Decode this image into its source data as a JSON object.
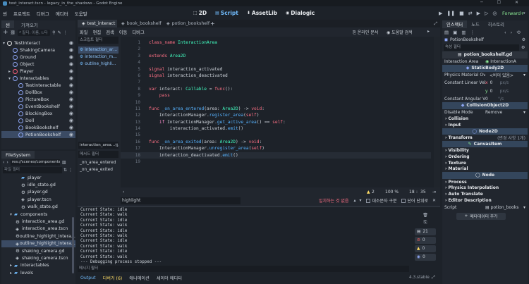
{
  "window": {
    "title": "test_interact.tscn - legacy_in_the_shadows - Godot Engine"
  },
  "menubar": {
    "items": [
      "씬",
      "프로젝트",
      "디버그",
      "에디터",
      "도움말"
    ]
  },
  "workspaces": {
    "items": [
      "2D",
      "Script",
      "AssetLib",
      "Dialogic"
    ],
    "active": "Script"
  },
  "renderer": "Forward+",
  "scene_dock": {
    "tabs": [
      "씬",
      "가져오기"
    ],
    "filter_placeholder": "필터: 이름, t:타",
    "nodes": [
      {
        "name": "TestInteract",
        "depth": 0,
        "color": "#e0e0e0",
        "visible": true,
        "collapse": "▾"
      },
      {
        "name": "ShakingCamera",
        "depth": 1,
        "color": "#8da5f3",
        "visible": true
      },
      {
        "name": "Ground",
        "depth": 1,
        "color": "#8da5f3",
        "visible": true
      },
      {
        "name": "Object",
        "depth": 1,
        "color": "#8da5f3",
        "visible": true
      },
      {
        "name": "Player",
        "depth": 1,
        "color": "#ff5f7a",
        "visible": true,
        "collapse": "▸"
      },
      {
        "name": "Interactables",
        "depth": 1,
        "color": "#8da5f3",
        "visible": true,
        "collapse": "▾"
      },
      {
        "name": "TestInteractable",
        "depth": 2,
        "color": "#8da5f3",
        "visible": true
      },
      {
        "name": "DollBox",
        "depth": 2,
        "color": "#8da5f3",
        "visible": true
      },
      {
        "name": "PictureBox",
        "depth": 2,
        "color": "#8da5f3",
        "visible": true
      },
      {
        "name": "EventBookshelf",
        "depth": 2,
        "color": "#8da5f3",
        "visible": true
      },
      {
        "name": "BlockingBox",
        "depth": 2,
        "color": "#8da5f3",
        "visible": true
      },
      {
        "name": "Doll",
        "depth": 2,
        "color": "#8da5f3",
        "visible": true
      },
      {
        "name": "BookBookshelf",
        "depth": 2,
        "color": "#8da5f3",
        "visible": true
      },
      {
        "name": "PotionBookshelf",
        "depth": 2,
        "color": "#8da5f3",
        "visible": true,
        "selected": true
      }
    ]
  },
  "filesystem": {
    "tab": "FileSystem",
    "path": "res://scenes/components/o",
    "filter_placeholder": "파일 필터",
    "items": [
      {
        "name": "player",
        "depth": 3,
        "type": "folder"
      },
      {
        "name": "idle_state.gd",
        "depth": 3,
        "type": "script"
      },
      {
        "name": "player.gd",
        "depth": 3,
        "type": "script"
      },
      {
        "name": "player.tscn",
        "depth": 3,
        "type": "scene"
      },
      {
        "name": "walk_state.gd",
        "depth": 3,
        "type": "script"
      },
      {
        "name": "components",
        "depth": 1,
        "type": "folder",
        "collapse": "▾"
      },
      {
        "name": "interaction_area.gd",
        "depth": 2,
        "type": "script"
      },
      {
        "name": "interaction_area.tscn",
        "depth": 2,
        "type": "scene"
      },
      {
        "name": "outline_highlight_intera…",
        "depth": 2,
        "type": "script"
      },
      {
        "name": "outline_highlight_intera…",
        "depth": 2,
        "type": "scene",
        "selected": true
      },
      {
        "name": "shaking_camera.gd",
        "depth": 2,
        "type": "script"
      },
      {
        "name": "shaking_camera.tscn",
        "depth": 2,
        "type": "scene"
      },
      {
        "name": "interactables",
        "depth": 1,
        "type": "folder",
        "collapse": "▸"
      },
      {
        "name": "levels",
        "depth": 1,
        "type": "folder",
        "collapse": "▸"
      }
    ]
  },
  "script_editor": {
    "tabs": [
      {
        "label": "test_interact",
        "active": true,
        "icon": "scene"
      },
      {
        "label": "book_bookshelf",
        "icon": "scene"
      },
      {
        "label": "potion_bookshelf",
        "icon": "scene"
      }
    ],
    "menu": [
      "파일",
      "편집",
      "검색",
      "이동",
      "디버그"
    ],
    "online_docs": "온라인 문서",
    "help_search": "도움말 검색",
    "script_filter": "스크립트 필터",
    "scripts": [
      "interaction_ar…",
      "interaction_m…",
      "outline_highli…"
    ],
    "current_script": "interaction_area…",
    "method_filter": "메서드 필터",
    "methods": [
      "_on_area_entered",
      "_on_area_exited"
    ],
    "line_count": 19,
    "highlight_line": 18,
    "cursor": {
      "line": "18",
      "col": "35"
    },
    "warnings": "2",
    "zoom": "100 %",
    "find": {
      "value": "highlight",
      "no_match": "일치하는 것 없음",
      "match_case": "대소문자 구분",
      "whole_words": "단어 단위로"
    }
  },
  "output": {
    "lines": [
      "Current State: idle",
      "Current State: walk",
      "Current State: idle",
      "Current State: walk",
      "Current State: idle",
      "Current State: walk",
      "Current State: idle",
      "Current State: walk",
      "Current State: idle",
      "Current State: walk",
      "--- Debugging process stopped ---"
    ],
    "filter_placeholder": "메시지 필터",
    "counts": [
      "21",
      "0",
      "0",
      "0"
    ],
    "bottom_tabs": [
      "Output",
      "디버거 (6)",
      "애니메이션",
      "셰이더 에디터"
    ],
    "version": "4.3.stable"
  },
  "inspector": {
    "tabs": [
      "인스펙터",
      "노드",
      "히스토리"
    ],
    "object": "PotionBookshelf",
    "filter_placeholder": "속성 필터",
    "script_file": "potion_bookshelf.gd",
    "interaction_area_label": "Interaction Area",
    "interaction_area_value": "InteractionA",
    "static_body": "StaticBody2D",
    "physics_material_label": "Physics Material Ove",
    "physics_material_value": "<비어 있음>",
    "linear_label": "Constant Linear Velo",
    "linear_x": "0",
    "linear_y": "0",
    "unit": "px/s",
    "angular_label": "Constant Angular Ve",
    "angular_value": "0",
    "angular_unit": "°/s",
    "collision_object": "CollisionObject2D",
    "disable_mode_label": "Disable Mode",
    "disable_mode_value": "Remove",
    "collision": "Collision",
    "input": "Input",
    "node2d": "Node2D",
    "transform": "Transform",
    "transform_note": "(변경 사항 1개)",
    "canvas_item": "CanvasItem",
    "visibility": "Visibility",
    "ordering": "Ordering",
    "texture": "Texture",
    "material": "Material",
    "node": "Node",
    "process": "Process",
    "physics_interpolation": "Physics Interpolation",
    "auto_translate": "Auto Translate",
    "editor_description": "Editor Description",
    "script_label": "Script",
    "script_value": "potion_books",
    "add_metadata": "메타데이터 추가"
  },
  "colors": {
    "accent": "#70bafa",
    "selected": "#3b4b64",
    "panel": "#21262e"
  }
}
